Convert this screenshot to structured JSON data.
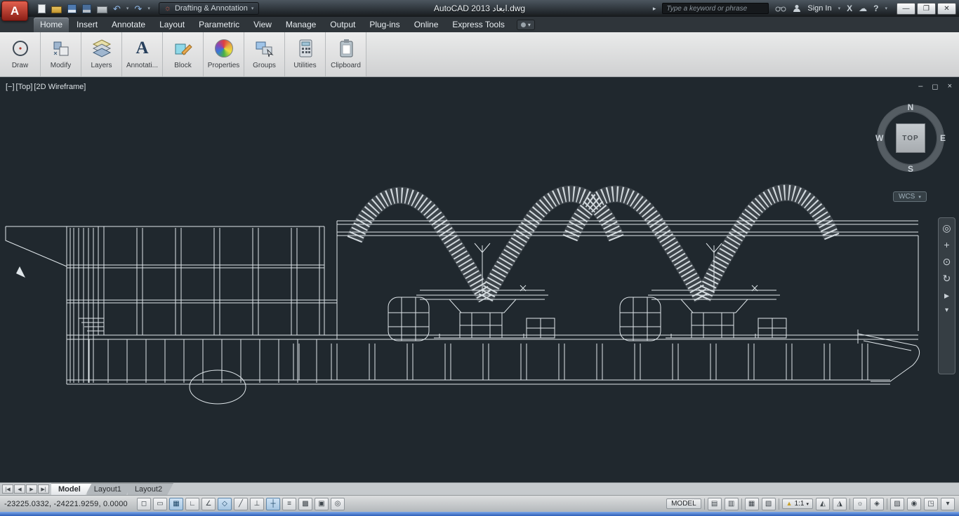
{
  "titlebar": {
    "app_initial": "A",
    "workspace_selector": "Drafting & Annotation",
    "title": "AutoCAD 2013 ابعاد.dwg",
    "search_placeholder": "Type a keyword or phrase",
    "sign_in_label": "Sign In"
  },
  "menu": {
    "tabs": [
      {
        "label": "Home",
        "active": true
      },
      {
        "label": "Insert"
      },
      {
        "label": "Annotate"
      },
      {
        "label": "Layout"
      },
      {
        "label": "Parametric"
      },
      {
        "label": "View"
      },
      {
        "label": "Manage"
      },
      {
        "label": "Output"
      },
      {
        "label": "Plug-ins"
      },
      {
        "label": "Online"
      },
      {
        "label": "Express Tools"
      }
    ]
  },
  "ribbon": {
    "panels": [
      "Draw",
      "Modify",
      "Layers",
      "Annotati...",
      "Block",
      "Properties",
      "Groups",
      "Utilities",
      "Clipboard"
    ]
  },
  "viewport": {
    "controls_label": "[−]",
    "view_label": "[Top]",
    "style_label": "[2D Wireframe]",
    "viewcube": {
      "north": "N",
      "south": "S",
      "east": "E",
      "west": "W",
      "top_face": "TOP"
    },
    "wcs_label": "WCS"
  },
  "navbar": {
    "icons": [
      {
        "name": "full-navigation-wheel",
        "glyph": "◎"
      },
      {
        "name": "pan",
        "glyph": "+"
      },
      {
        "name": "zoom",
        "glyph": "⊙"
      },
      {
        "name": "orbit",
        "glyph": "↻"
      },
      {
        "name": "showmotion",
        "glyph": "▸"
      },
      {
        "name": "navbar-menu",
        "glyph": "▾"
      }
    ]
  },
  "layout_bar": {
    "tabs": [
      {
        "label": "Model",
        "active": true
      },
      {
        "label": "Layout1"
      },
      {
        "label": "Layout2"
      }
    ]
  },
  "statusbar": {
    "coordinates": "-23225.0332, -24221.9259, 0.0000",
    "toggles": [
      {
        "name": "infer-constraints",
        "glyph": "◻",
        "active": false
      },
      {
        "name": "snap",
        "glyph": "▭",
        "active": false
      },
      {
        "name": "grid",
        "glyph": "▦",
        "active": true
      },
      {
        "name": "ortho",
        "glyph": "∟",
        "active": false
      },
      {
        "name": "polar",
        "glyph": "∠",
        "active": false
      },
      {
        "name": "osnap",
        "glyph": "◇",
        "active": true
      },
      {
        "name": "otrack",
        "glyph": "╱",
        "active": false
      },
      {
        "name": "dynucs",
        "glyph": "⊥",
        "active": false
      },
      {
        "name": "dyninput",
        "glyph": "┼",
        "active": true
      },
      {
        "name": "lineweight",
        "glyph": "≡",
        "active": false
      },
      {
        "name": "transparency",
        "glyph": "▩",
        "active": false
      },
      {
        "name": "quick-properties",
        "glyph": "▣",
        "active": false
      },
      {
        "name": "selection-cycling",
        "glyph": "◎",
        "active": false
      }
    ],
    "model_label": "MODEL",
    "annotation_scale": "1:1",
    "right_items": [
      {
        "name": "model-space",
        "glyph": "▤"
      },
      {
        "name": "paper-space",
        "glyph": "▥"
      },
      {
        "name": "quickview-drawings",
        "glyph": "▦"
      },
      {
        "name": "quickview-layouts",
        "glyph": "▧"
      },
      {
        "name": "annotation-visibility",
        "glyph": "◭"
      },
      {
        "name": "annotation-autoscale",
        "glyph": "◮"
      },
      {
        "name": "workspace-switching",
        "glyph": "☼"
      },
      {
        "name": "toolbar-lock",
        "glyph": "◈"
      },
      {
        "name": "performance",
        "glyph": "▨"
      },
      {
        "name": "isolate-objects",
        "glyph": "◉"
      },
      {
        "name": "clean-screen",
        "glyph": "◳"
      },
      {
        "name": "status-menu",
        "glyph": "▾"
      }
    ]
  },
  "colors": {
    "canvas_background": "#20282e",
    "wireframe_line": "#dfe6ea",
    "app_brand_red": "#a32a1e",
    "taskbar_blue": "#2f5fb8"
  }
}
